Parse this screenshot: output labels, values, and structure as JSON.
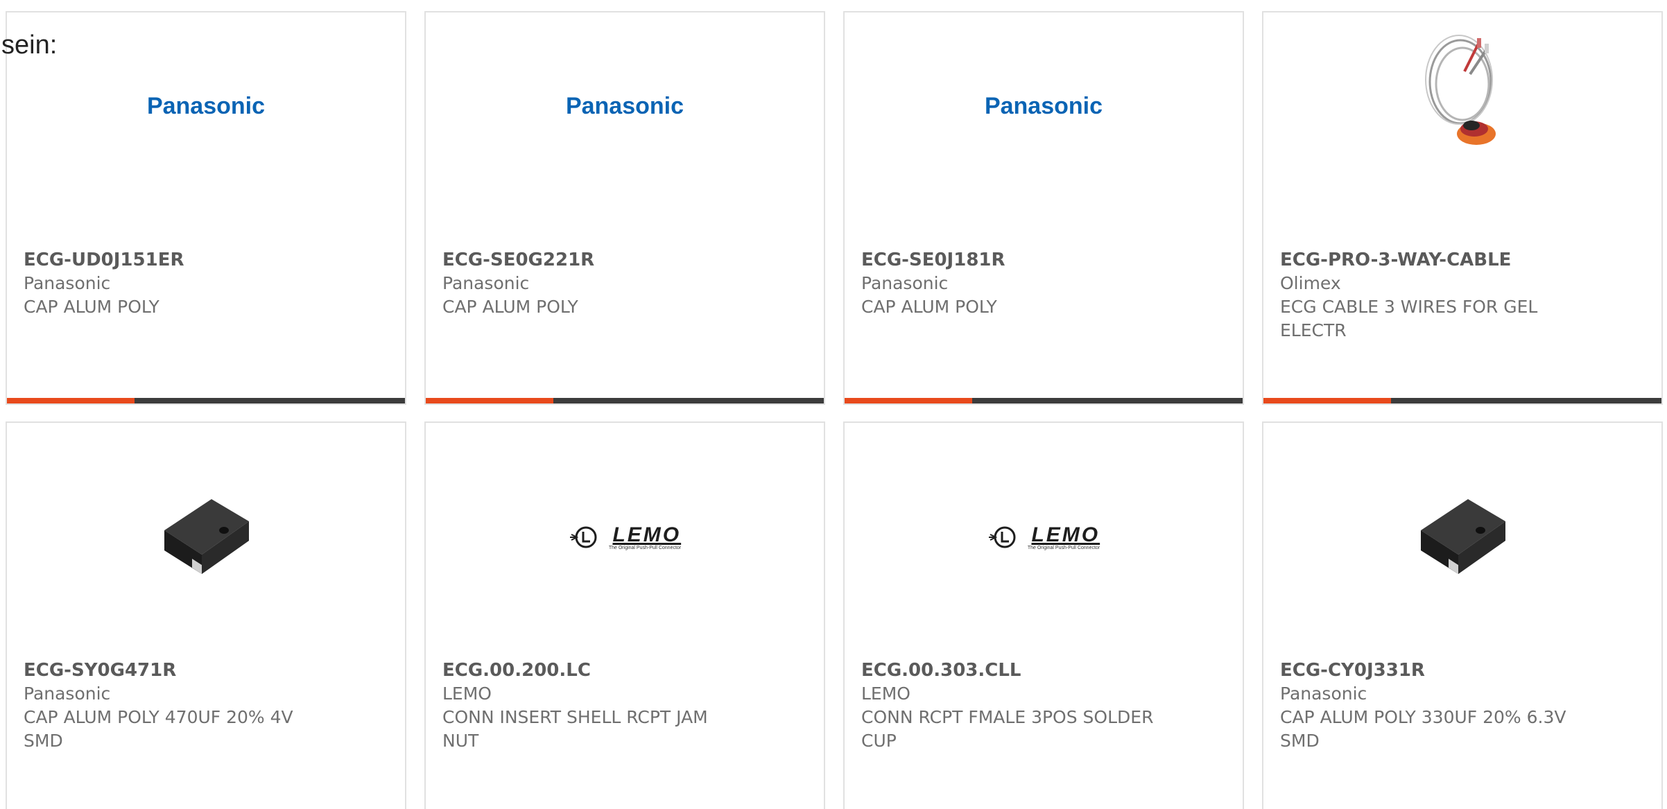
{
  "header": {
    "text": "sein:"
  },
  "products": [
    {
      "part_number": "ECG-UD0J151ER",
      "manufacturer": "Panasonic",
      "description": "CAP ALUM POLY",
      "image_icon": "panasonic-logo",
      "brand_text": "Panasonic"
    },
    {
      "part_number": "ECG-SE0G221R",
      "manufacturer": "Panasonic",
      "description": "CAP ALUM POLY",
      "image_icon": "panasonic-logo",
      "brand_text": "Panasonic"
    },
    {
      "part_number": "ECG-SE0J181R",
      "manufacturer": "Panasonic",
      "description": "CAP ALUM POLY",
      "image_icon": "panasonic-logo",
      "brand_text": "Panasonic"
    },
    {
      "part_number": "ECG-PRO-3-WAY-CABLE",
      "manufacturer": "Olimex",
      "description": "ECG CABLE 3 WIRES FOR GEL ELECTR",
      "image_icon": "ecg-cable-photo"
    },
    {
      "part_number": "ECG-SY0G471R",
      "manufacturer": "Panasonic",
      "description": "CAP ALUM POLY 470UF 20% 4V SMD",
      "image_icon": "smd-capacitor-photo"
    },
    {
      "part_number": "ECG.00.200.LC",
      "manufacturer": "LEMO",
      "description": "CONN INSERT SHELL RCPT JAM NUT",
      "image_icon": "lemo-logo",
      "brand_text": "LEMO",
      "brand_tagline": "The Original Push-Pull Connector"
    },
    {
      "part_number": "ECG.00.303.CLL",
      "manufacturer": "LEMO",
      "description": "CONN RCPT FMALE 3POS SOLDER CUP",
      "image_icon": "lemo-logo",
      "brand_text": "LEMO",
      "brand_tagline": "The Original Push-Pull Connector"
    },
    {
      "part_number": "ECG-CY0J331R",
      "manufacturer": "Panasonic",
      "description": "CAP ALUM POLY 330UF 20% 6.3V SMD",
      "image_icon": "smd-capacitor-photo"
    }
  ],
  "colors": {
    "accent": "#e84a1c",
    "bar": "#3c3c3c",
    "border": "#e1e1e1",
    "panasonic_blue": "#0a64b4",
    "text_bold": "#5a5a5a",
    "text_regular": "#6f6f6f"
  }
}
